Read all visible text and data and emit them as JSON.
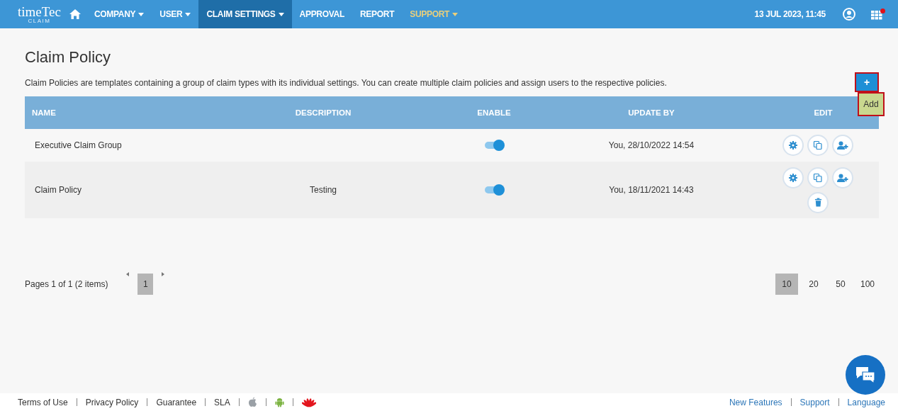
{
  "brand": {
    "name": "timeTec",
    "sub": "CLAIM"
  },
  "nav": [
    {
      "label": "COMPANY",
      "dropdown": true,
      "selected": false,
      "accent": false
    },
    {
      "label": "USER",
      "dropdown": true,
      "selected": false,
      "accent": false
    },
    {
      "label": "CLAIM SETTINGS",
      "dropdown": true,
      "selected": true,
      "accent": false
    },
    {
      "label": "APPROVAL",
      "dropdown": false,
      "selected": false,
      "accent": false
    },
    {
      "label": "REPORT",
      "dropdown": false,
      "selected": false,
      "accent": false
    },
    {
      "label": "SUPPORT",
      "dropdown": true,
      "selected": false,
      "accent": true
    }
  ],
  "datetime": "13 JUL 2023, 11:45",
  "notification": true,
  "page": {
    "title": "Claim Policy",
    "description": "Claim Policies are templates containing a group of claim types with its individual settings. You can create multiple claim policies and assign users to the respective policies.",
    "add_button": "+",
    "add_tooltip": "Add"
  },
  "table": {
    "columns": [
      "NAME",
      "DESCRIPTION",
      "ENABLE",
      "UPDATE BY",
      "EDIT"
    ],
    "rows": [
      {
        "name": "Executive Claim Group",
        "description": "",
        "on": true,
        "update_by": "You, 28/10/2022 14:54",
        "actions": [
          {
            "kind": "settings"
          },
          {
            "kind": "copy"
          },
          {
            "kind": "assign"
          }
        ]
      },
      {
        "name": "Claim Policy",
        "description": "Testing",
        "on": true,
        "update_by": "You, 18/11/2021 14:43",
        "actions": [
          {
            "kind": "settings"
          },
          {
            "kind": "copy"
          },
          {
            "kind": "assign"
          },
          {
            "kind": "delete"
          }
        ]
      }
    ]
  },
  "pagination": {
    "summary": "Pages 1 of 1 (2 items)",
    "pages": [
      {
        "label": "1",
        "selected": true
      }
    ],
    "sizes": [
      {
        "label": "10",
        "selected": true
      },
      {
        "label": "20",
        "selected": false
      },
      {
        "label": "50",
        "selected": false
      },
      {
        "label": "100",
        "selected": false
      }
    ]
  },
  "footer": {
    "left": [
      {
        "kind": "link",
        "label": "Terms of Use"
      },
      {
        "kind": "link",
        "label": "Privacy Policy"
      },
      {
        "kind": "link",
        "label": "Guarantee"
      },
      {
        "kind": "link",
        "label": "SLA"
      },
      {
        "kind": "apple"
      },
      {
        "kind": "android"
      },
      {
        "kind": "huawei"
      }
    ],
    "right": [
      "New Features",
      "Support",
      "Language"
    ]
  }
}
